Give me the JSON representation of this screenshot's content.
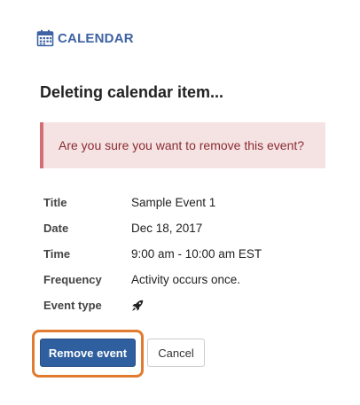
{
  "tool": {
    "title": "CALENDAR",
    "icon": "calendar-icon",
    "color": "#3e62a3"
  },
  "page": {
    "title": "Deleting calendar item..."
  },
  "alert": {
    "message": "Are you sure you want to remove this event?",
    "background": "#f5e3e3",
    "border_color": "#d26f74",
    "text_color": "#8a2b32"
  },
  "event": {
    "rows": [
      {
        "label": "Title",
        "value": "Sample Event 1"
      },
      {
        "label": "Date",
        "value": "Dec 18, 2017"
      },
      {
        "label": "Time",
        "value": "9:00 am - 10:00 am EST"
      },
      {
        "label": "Frequency",
        "value": "Activity occurs once."
      },
      {
        "label": "Event type",
        "icon": "rocket-icon"
      }
    ]
  },
  "actions": {
    "remove_label": "Remove event",
    "cancel_label": "Cancel",
    "primary_color": "#2f5f9e",
    "highlight_color": "#e07b2f"
  }
}
